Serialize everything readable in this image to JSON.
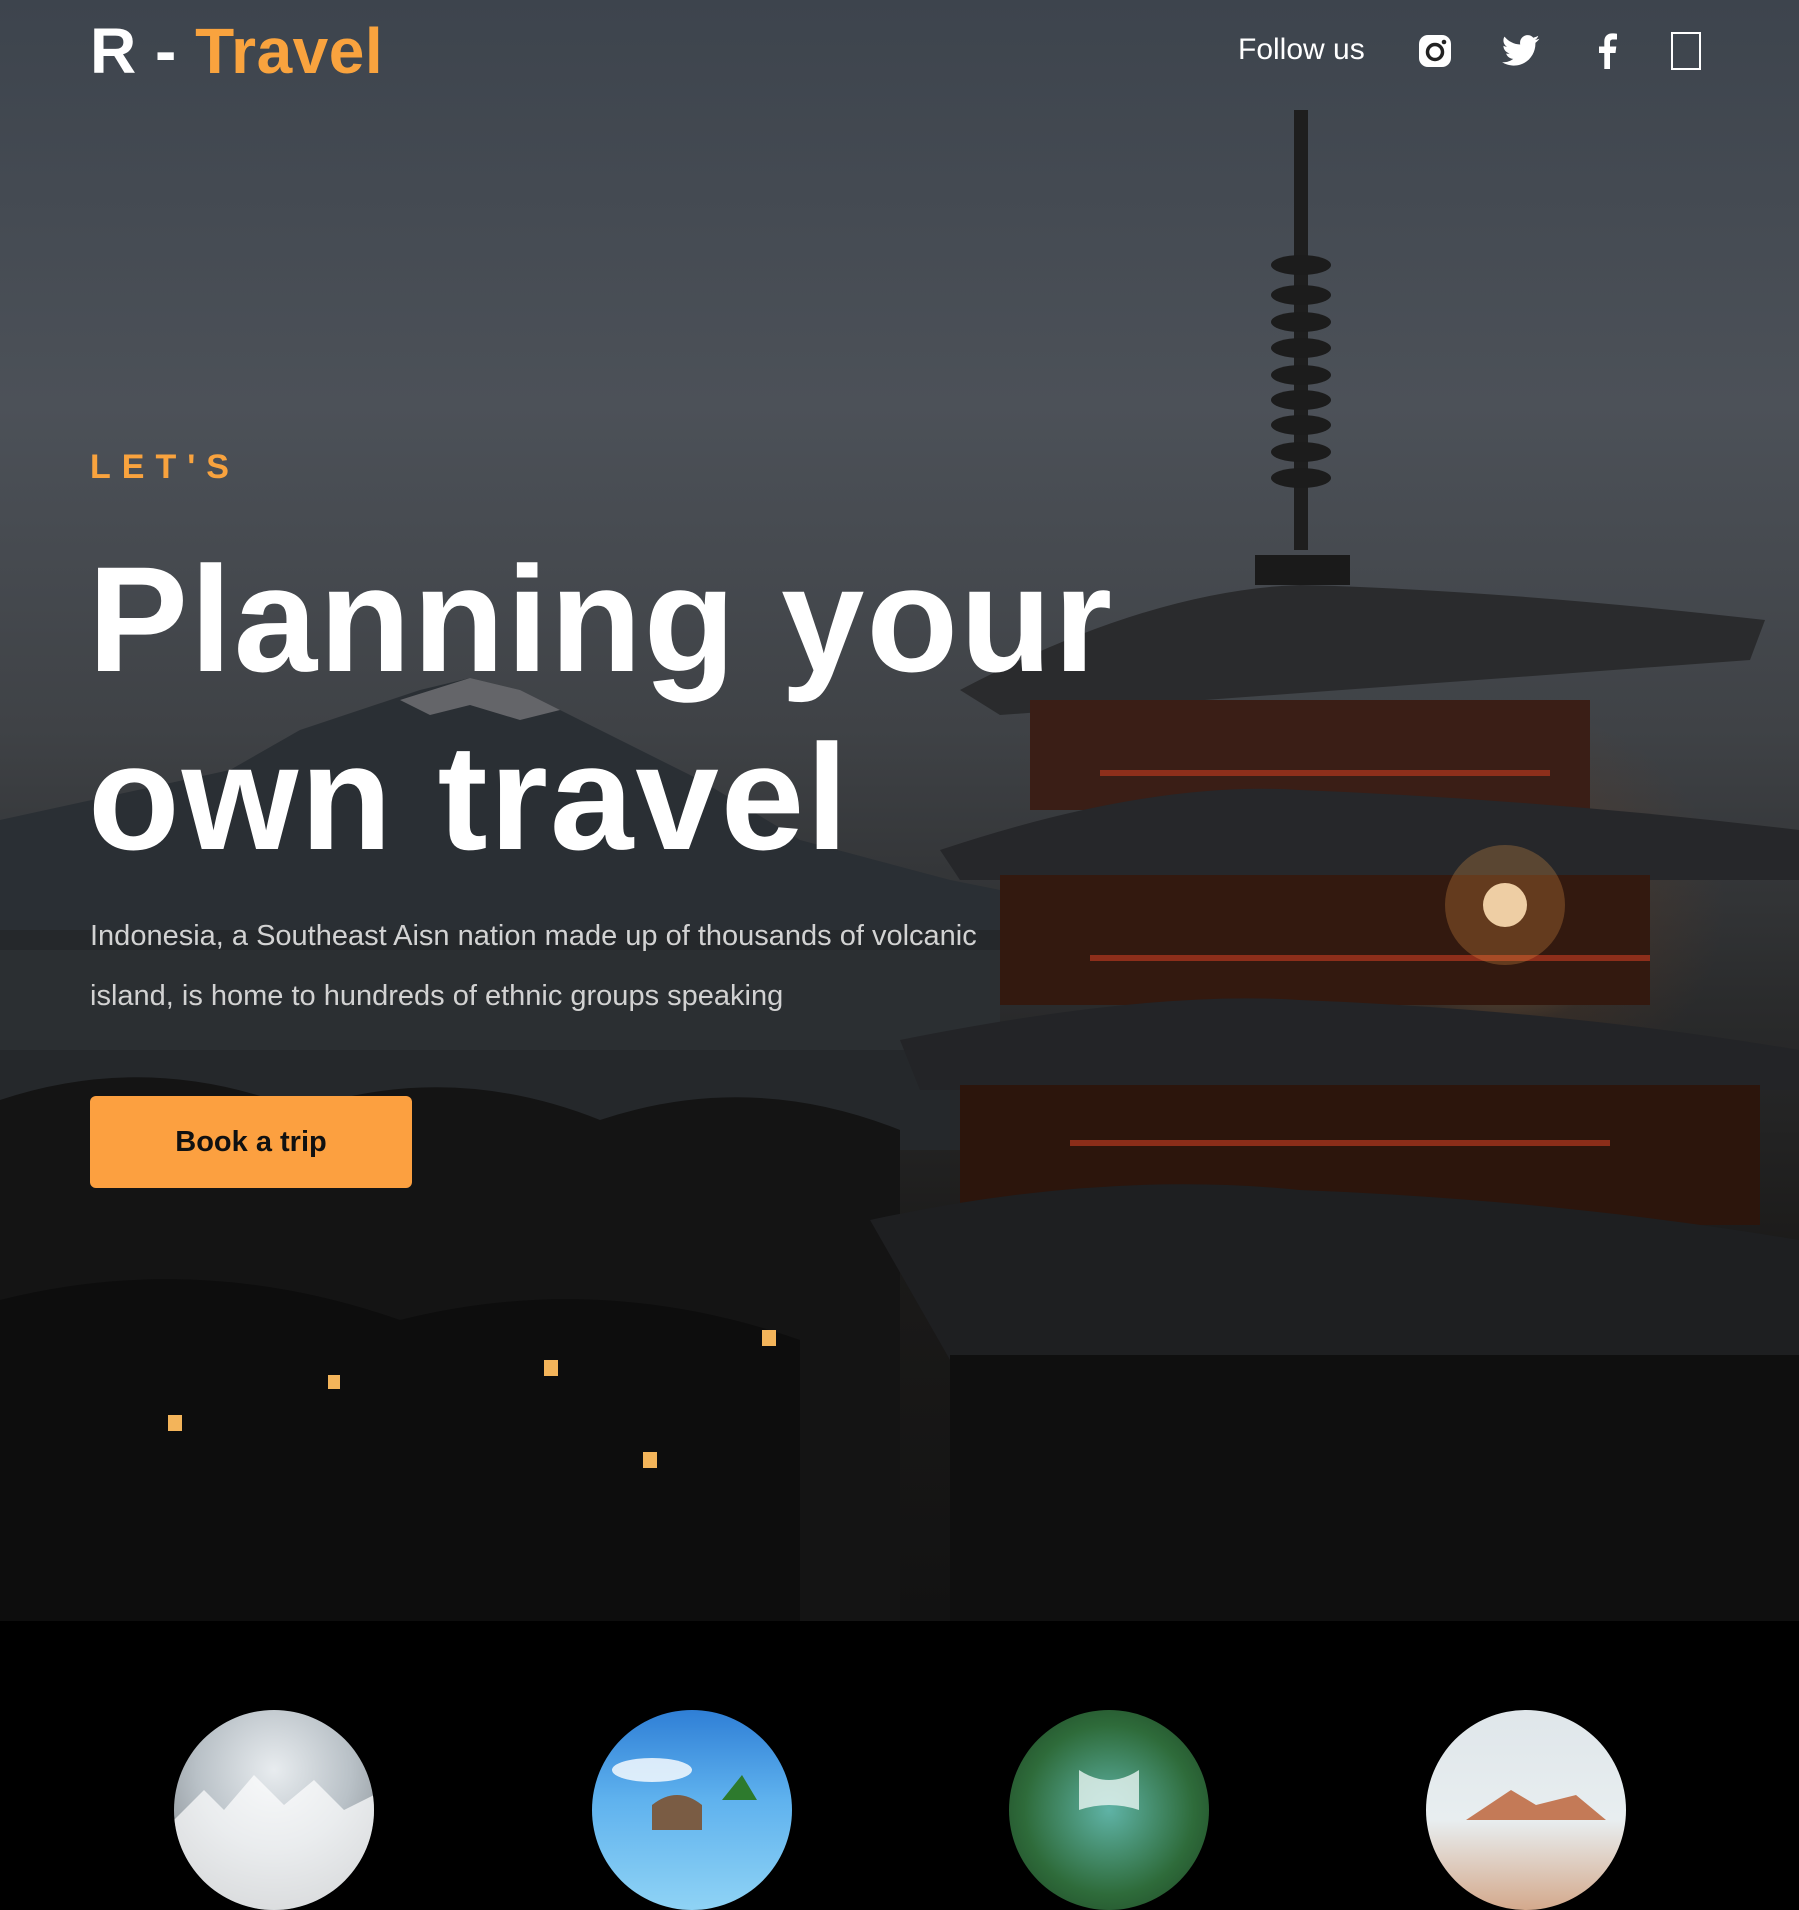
{
  "brand": {
    "prefix": "R -",
    "name": "Travel"
  },
  "nav": {
    "follow_label": "Follow us",
    "social_icons": [
      "instagram-icon",
      "twitter-icon",
      "facebook-icon",
      "placeholder-icon"
    ]
  },
  "hero": {
    "kicker": "LET'S",
    "headline_line1": "Planning your",
    "headline_line2": "own travel",
    "description": "Indonesia, a Southeast Aisn nation made up of thousands of volcanic island, is home to hundreds of ethnic groups speaking",
    "cta_label": "Book a trip"
  },
  "destinations": {
    "thumbnails": [
      "snowy-forest",
      "tropical-beach",
      "waterfall",
      "desert-mountain"
    ]
  },
  "colors": {
    "accent": "#f9a33e",
    "button": "#fca040",
    "background": "#000000",
    "text": "#ffffff"
  }
}
